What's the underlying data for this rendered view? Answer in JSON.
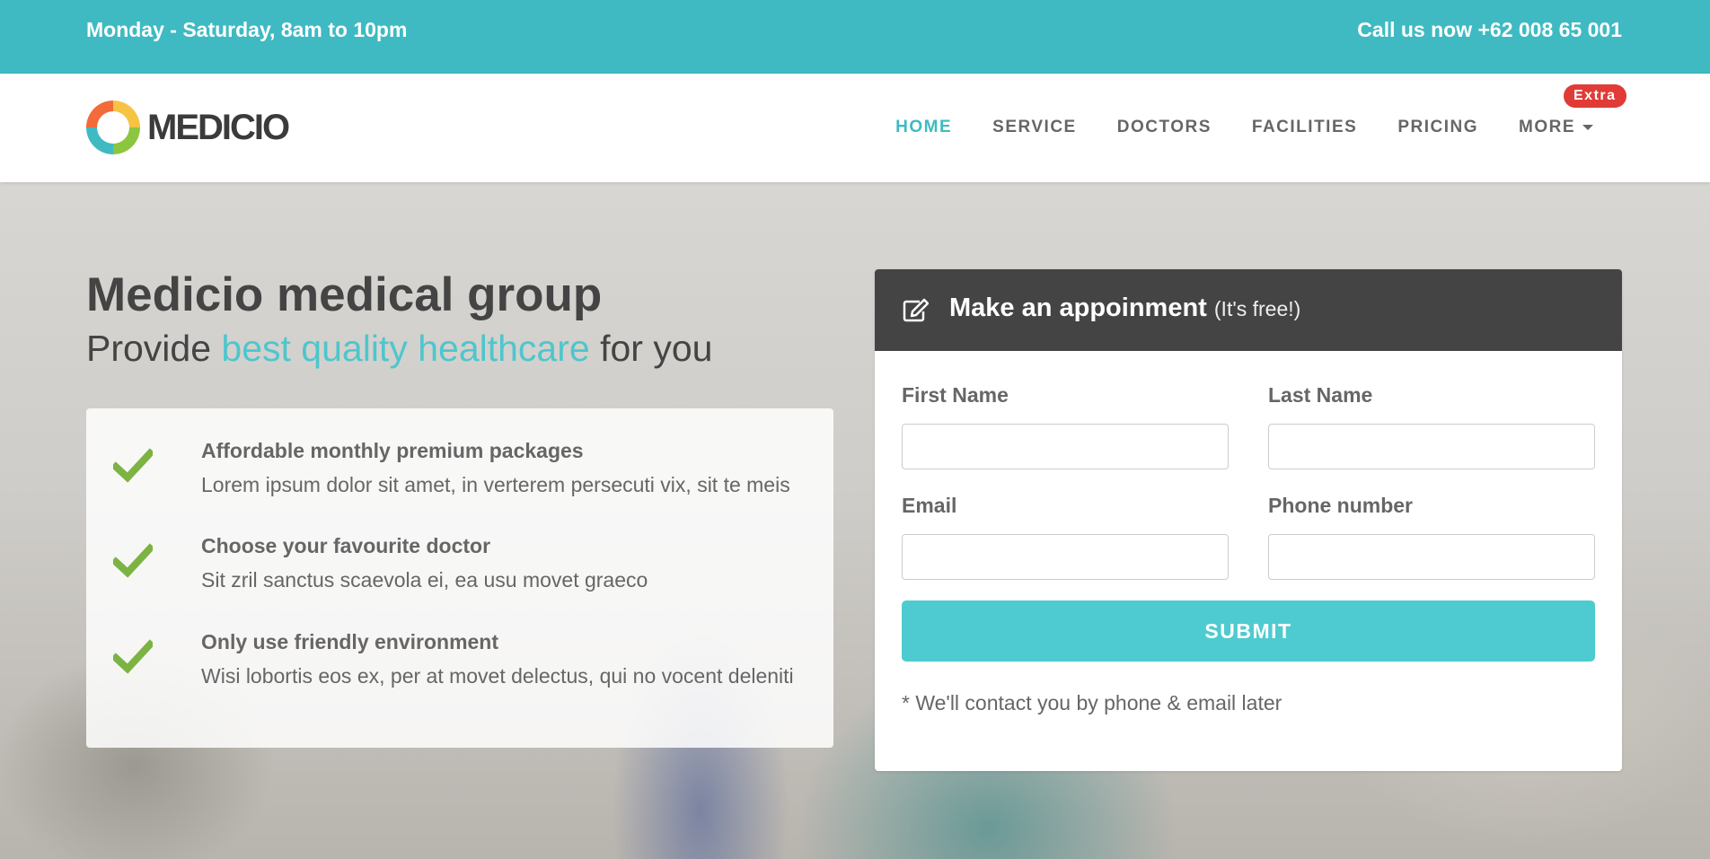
{
  "topbar": {
    "hours": "Monday - Saturday, 8am to 10pm",
    "phone": "Call us now +62 008 65 001"
  },
  "brand": {
    "name": "MEDICIO"
  },
  "nav": {
    "items": [
      {
        "label": "HOME",
        "active": true
      },
      {
        "label": "SERVICE"
      },
      {
        "label": "DOCTORS"
      },
      {
        "label": "FACILITIES"
      },
      {
        "label": "PRICING"
      },
      {
        "label": "MORE",
        "has_dropdown": true,
        "badge": "Extra"
      }
    ]
  },
  "hero": {
    "title": "Medicio medical group",
    "subtitle_pre": "Provide ",
    "subtitle_highlight": "best quality healthcare",
    "subtitle_post": " for you",
    "features": [
      {
        "icon": "check-icon",
        "title": "Affordable monthly premium packages",
        "desc": "Lorem ipsum dolor sit amet, in verterem persecuti vix, sit te meis"
      },
      {
        "icon": "check-icon",
        "title": "Choose your favourite doctor",
        "desc": "Sit zril sanctus scaevola ei, ea usu movet graeco"
      },
      {
        "icon": "check-icon",
        "title": "Only use friendly environment",
        "desc": "Wisi lobortis eos ex, per at movet delectus, qui no vocent deleniti"
      }
    ]
  },
  "appointment": {
    "icon": "edit-icon",
    "title": "Make an appoinment",
    "title_note": "(It's free!)",
    "fields": {
      "first_name": {
        "label": "First Name",
        "value": ""
      },
      "last_name": {
        "label": "Last Name",
        "value": ""
      },
      "email": {
        "label": "Email",
        "value": ""
      },
      "phone": {
        "label": "Phone number",
        "value": ""
      }
    },
    "submit_label": "SUBMIT",
    "note": "* We'll contact you by phone & email later"
  },
  "colors": {
    "accent": "#3fbac2",
    "button": "#4ecbd0",
    "badge": "#e03b36",
    "check": "#7cb342",
    "panel_header": "#444444"
  }
}
